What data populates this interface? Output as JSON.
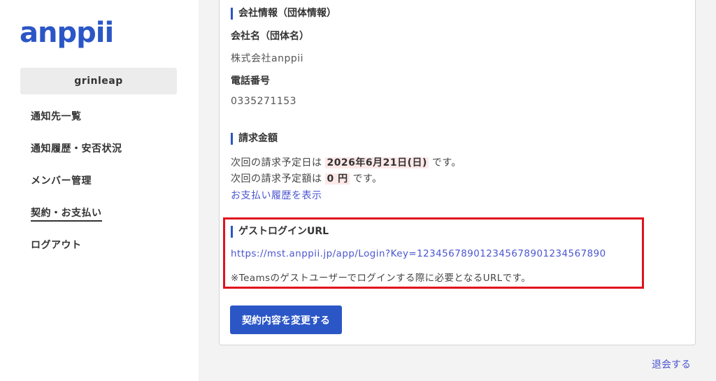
{
  "sidebar": {
    "logo": "anppii",
    "org_name": "grinleap",
    "nav": [
      {
        "label": "通知先一覧"
      },
      {
        "label": "通知履歴・安否状況"
      },
      {
        "label": "メンバー管理"
      },
      {
        "label": "契約・お支払い",
        "active": true
      },
      {
        "label": "ログアウト"
      }
    ]
  },
  "company": {
    "section_title": "会社情報（団体情報）",
    "name_label": "会社名（団体名）",
    "name_value": "株式会社anppii",
    "phone_label": "電話番号",
    "phone_value": "0335271153"
  },
  "billing": {
    "section_title": "請求金額",
    "date_prefix": "次回の請求予定日は",
    "date_value": "2026年6月21日(日)",
    "date_suffix": "です。",
    "amount_prefix": "次回の請求予定額は",
    "amount_value": "0 円",
    "amount_suffix": "です。",
    "history_link": "お支払い履歴を表示"
  },
  "guest": {
    "section_title": "ゲストログインURL",
    "url": "https://mst.anppii.jp/app/Login?Key=12345678901234567890123456789­0",
    "note": "※Teamsのゲストユーザーでログインする際に必要となるURLです。"
  },
  "actions": {
    "change_button": "契約内容を変更する",
    "withdraw_link": "退会する"
  },
  "colors": {
    "brand": "#2b56c6",
    "link": "#4a55d0",
    "highlight_border": "#e0121d"
  }
}
